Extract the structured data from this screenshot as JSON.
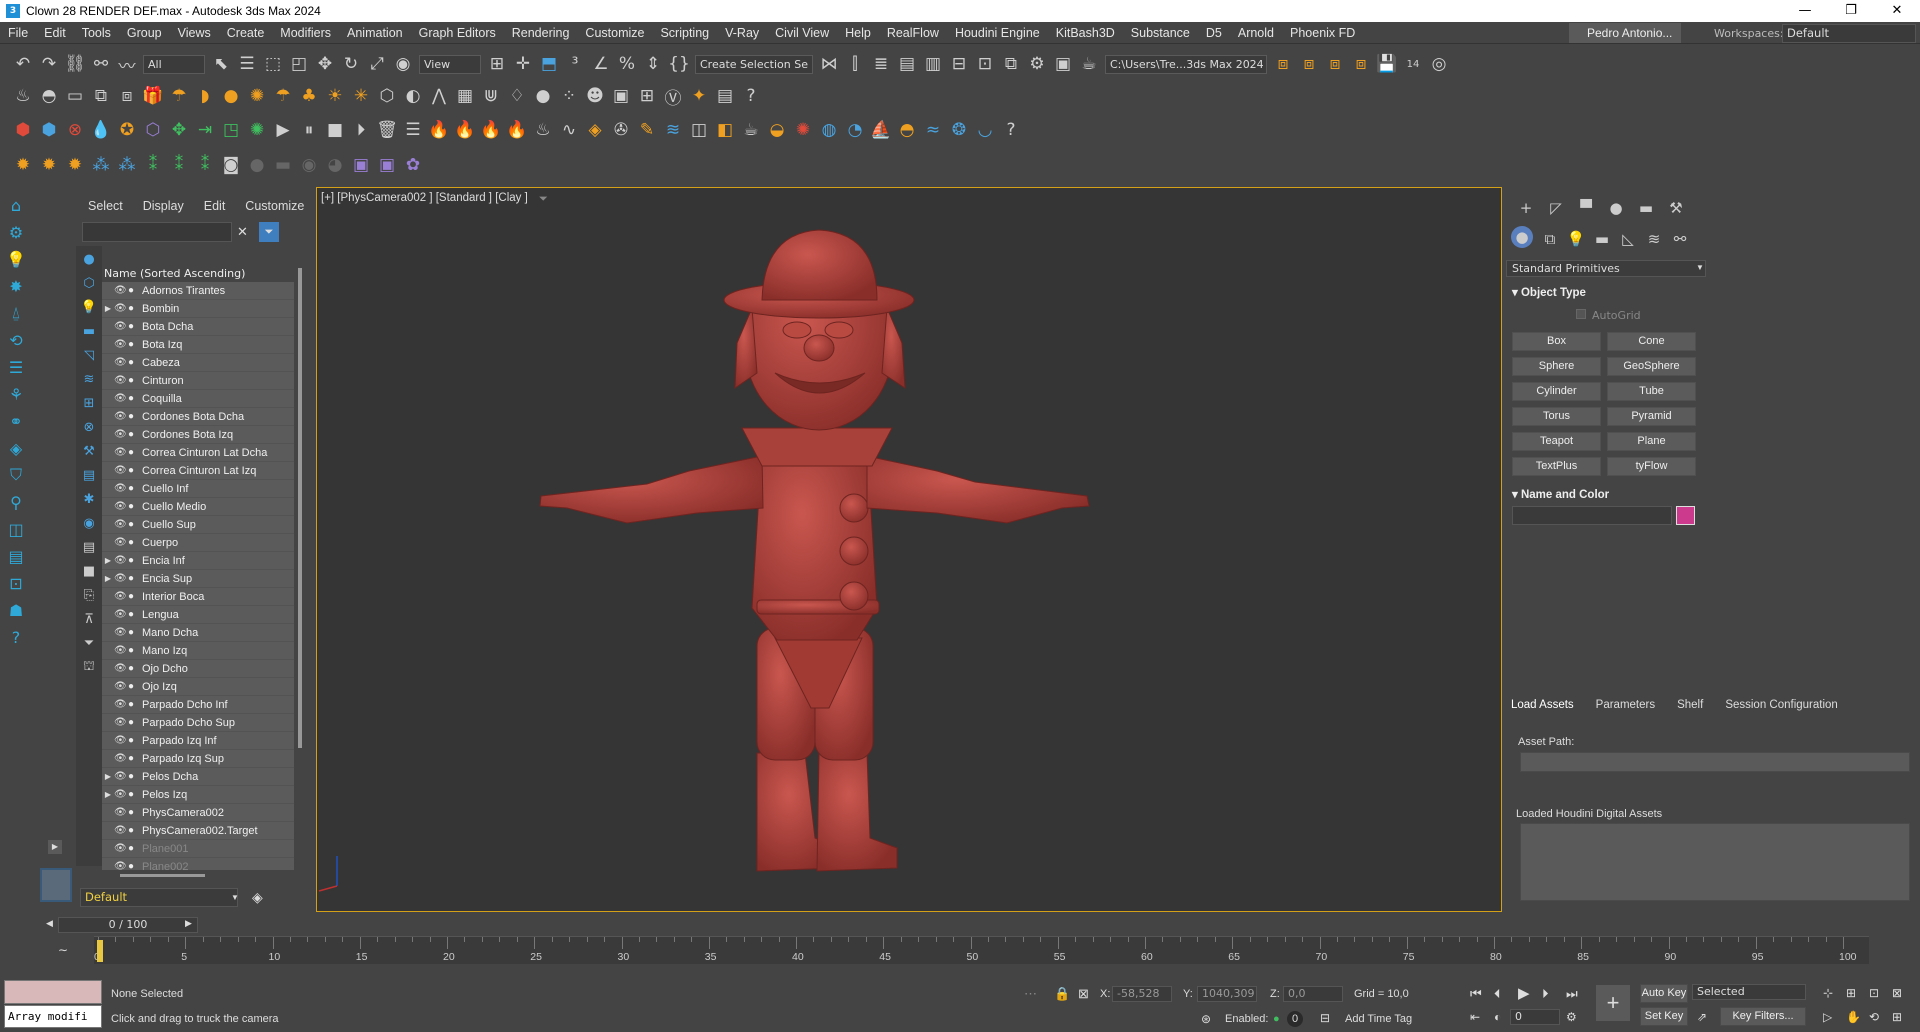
{
  "window": {
    "title": "Clown 28 RENDER DEF.max - Autodesk 3ds Max 2024",
    "minimize": "—",
    "maximize": "❐",
    "close": "✕"
  },
  "menu": [
    "File",
    "Edit",
    "Tools",
    "Group",
    "Views",
    "Create",
    "Modifiers",
    "Animation",
    "Graph Editors",
    "Rendering",
    "Customize",
    "Scripting",
    "V-Ray",
    "Civil View",
    "Help",
    "RealFlow",
    "Houdini Engine",
    "KitBash3D",
    "Substance",
    "D5",
    "Arnold",
    "Phoenix FD"
  ],
  "user": "Pedro Antonio...",
  "workspaces": {
    "label": "Workspaces:",
    "value": "Default"
  },
  "toolbar": {
    "filter": "All",
    "refcoord": "View",
    "selset": "Create Selection Se",
    "path": "C:\\Users\\Tre...3ds Max 2024",
    "badge": "14"
  },
  "scene_explorer": {
    "tabs": [
      "Select",
      "Display",
      "Edit",
      "Customize"
    ],
    "header": "Name (Sorted Ascending)",
    "rows": [
      {
        "name": "Adornos Tirantes",
        "exp": ""
      },
      {
        "name": "Bombin",
        "exp": "▶"
      },
      {
        "name": "Bota Dcha",
        "exp": ""
      },
      {
        "name": "Bota Izq",
        "exp": ""
      },
      {
        "name": "Cabeza",
        "exp": ""
      },
      {
        "name": "Cinturon",
        "exp": ""
      },
      {
        "name": "Coquilla",
        "exp": ""
      },
      {
        "name": "Cordones Bota Dcha",
        "exp": ""
      },
      {
        "name": "Cordones Bota Izq",
        "exp": ""
      },
      {
        "name": "Correa Cinturon Lat Dcha",
        "exp": ""
      },
      {
        "name": "Correa Cinturon Lat Izq",
        "exp": ""
      },
      {
        "name": "Cuello Inf",
        "exp": ""
      },
      {
        "name": "Cuello Medio",
        "exp": ""
      },
      {
        "name": "Cuello Sup",
        "exp": ""
      },
      {
        "name": "Cuerpo",
        "exp": ""
      },
      {
        "name": "Encia Inf",
        "exp": "▶"
      },
      {
        "name": "Encia Sup",
        "exp": "▶"
      },
      {
        "name": "Interior Boca",
        "exp": ""
      },
      {
        "name": "Lengua",
        "exp": ""
      },
      {
        "name": "Mano Dcha",
        "exp": ""
      },
      {
        "name": "Mano Izq",
        "exp": ""
      },
      {
        "name": "Ojo Dcho",
        "exp": ""
      },
      {
        "name": "Ojo Izq",
        "exp": ""
      },
      {
        "name": "Parpado Dcho Inf",
        "exp": ""
      },
      {
        "name": "Parpado Dcho Sup",
        "exp": ""
      },
      {
        "name": "Parpado Izq Inf",
        "exp": ""
      },
      {
        "name": "Parpado Izq Sup",
        "exp": ""
      },
      {
        "name": "Pelos Dcha",
        "exp": "▶"
      },
      {
        "name": "Pelos Izq",
        "exp": "▶"
      },
      {
        "name": "PhysCamera002",
        "exp": ""
      },
      {
        "name": "PhysCamera002.Target",
        "exp": ""
      },
      {
        "name": "Plane001",
        "exp": "",
        "dim": true
      },
      {
        "name": "Plane002",
        "exp": "",
        "dim": true
      }
    ],
    "layer": "Default"
  },
  "viewport": {
    "label": "[+] [PhysCamera002 ] [Standard ] [Clay ]"
  },
  "command_panel": {
    "category": "Standard Primitives",
    "object_type": "Object Type",
    "autogrid": "AutoGrid",
    "buttons": [
      "Box",
      "Cone",
      "Sphere",
      "GeoSphere",
      "Cylinder",
      "Tube",
      "Torus",
      "Pyramid",
      "Teapot",
      "Plane",
      "TextPlus",
      "tyFlow"
    ],
    "name_and_color": "Name and Color",
    "swatch_color": "#cc3a8e"
  },
  "houdini": {
    "tabs": [
      "Load Assets",
      "Parameters",
      "Shelf",
      "Session Configuration"
    ],
    "asset_path": "Asset Path:",
    "loaded": "Loaded Houdini Digital Assets"
  },
  "timeline": {
    "frame": "0 / 100",
    "ticks": [
      "0",
      "5",
      "10",
      "15",
      "20",
      "25",
      "30",
      "35",
      "40",
      "45",
      "50",
      "55",
      "60",
      "65",
      "70",
      "75",
      "80",
      "85",
      "90",
      "95",
      "100"
    ],
    "current": 0,
    "end": 100
  },
  "status": {
    "script": "Array modifi",
    "selected": "None Selected",
    "prompt": "Click and drag to truck the camera",
    "x": "-58,528",
    "y": "1040,309",
    "z": "0,0",
    "grid": "Grid = 10,0",
    "enabled": "Enabled:",
    "enabled_val": "0",
    "add_time_tag": "Add Time Tag",
    "auto_key": "Auto Key",
    "set_key": "Set Key",
    "selected_dd": "Selected",
    "key_filters": "Key Filters...",
    "frame_field": "0"
  }
}
